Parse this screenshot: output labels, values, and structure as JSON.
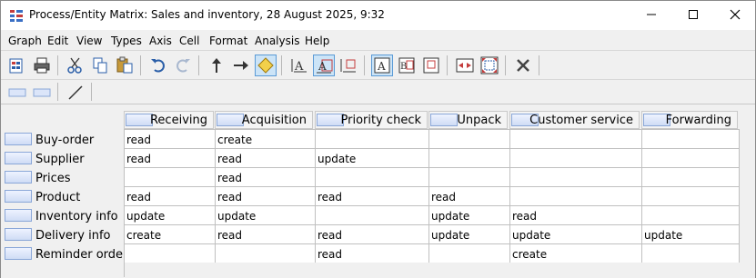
{
  "window": {
    "title": "Process/Entity Matrix: Sales and inventory, 28 August 2025, 9:32"
  },
  "menu": [
    "Graph",
    "Edit",
    "View",
    "Types",
    "Axis",
    "Cell",
    "Format",
    "Analysis",
    "Help"
  ],
  "toolbar": {
    "buttons": [
      "open-doc",
      "print",
      "cut",
      "copy",
      "paste",
      "undo",
      "redo",
      "arrow-up",
      "arrow-right",
      "diamond",
      "text-a-underline",
      "text-a-box",
      "text-a-line",
      "text-a-frame",
      "text-ba-frame",
      "text-frame",
      "expand",
      "select-all",
      "delete"
    ]
  },
  "matrix": {
    "columns": [
      "Receiving",
      "Acquisition",
      "Priority check",
      "Unpack",
      "Customer service",
      "Forwarding"
    ],
    "rows": [
      {
        "label": "Buy-order",
        "cells": [
          "read",
          "create",
          "",
          "",
          "",
          ""
        ]
      },
      {
        "label": "Supplier",
        "cells": [
          "read",
          "read",
          "update",
          "",
          "",
          ""
        ]
      },
      {
        "label": "Prices",
        "cells": [
          "",
          "read",
          "",
          "",
          "",
          ""
        ]
      },
      {
        "label": "Product",
        "cells": [
          "read",
          "read",
          "read",
          "read",
          "",
          ""
        ]
      },
      {
        "label": "Inventory info",
        "cells": [
          "update",
          "update",
          "",
          "update",
          "read",
          ""
        ]
      },
      {
        "label": "Delivery info",
        "cells": [
          "create",
          "read",
          "read",
          "update",
          "update",
          "update"
        ]
      },
      {
        "label": "Reminder order",
        "cells": [
          "",
          "",
          "read",
          "",
          "create",
          ""
        ]
      }
    ]
  },
  "colors": {
    "header_icon_border": "#8aa7d8",
    "active_button": "#cce4f7",
    "icon_blue": "#2a5ea8"
  }
}
